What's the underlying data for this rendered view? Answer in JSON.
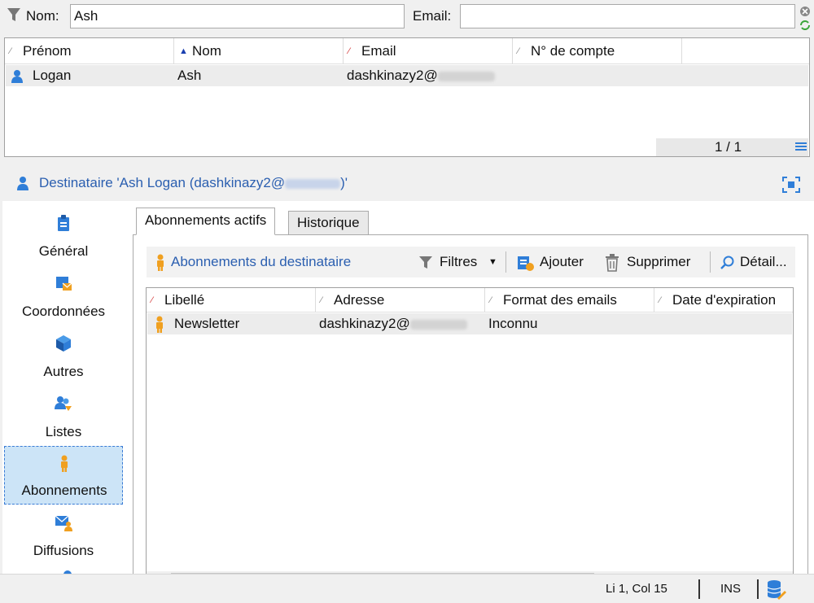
{
  "filter": {
    "nom_label": "Nom:",
    "nom_value": "Ash",
    "email_label": "Email:",
    "email_value": ""
  },
  "top_grid": {
    "columns": [
      "Prénom",
      "Nom",
      "Email",
      "N° de compte"
    ],
    "rows": [
      {
        "prenom": "Logan",
        "nom": "Ash",
        "email": "dashkinazy2@",
        "compte": ""
      }
    ],
    "pager": "1 / 1"
  },
  "recipient_header": {
    "title_prefix": "Destinataire 'Ash Logan (dashkinazy2@",
    "title_suffix": ")'"
  },
  "left_nav": {
    "items": [
      {
        "label": "Général",
        "icon": "clipboard-icon"
      },
      {
        "label": "Coordonnées",
        "icon": "contact-card-icon"
      },
      {
        "label": "Autres",
        "icon": "cube-icon"
      },
      {
        "label": "Listes",
        "icon": "group-list-icon"
      },
      {
        "label": "Abonnements",
        "icon": "subscription-person-icon",
        "selected": true
      },
      {
        "label": "Diffusions",
        "icon": "envelope-person-icon"
      }
    ]
  },
  "tabs": {
    "active": "Abonnements actifs",
    "other": "Historique"
  },
  "toolbar": {
    "title": "Abonnements du destinataire",
    "filtres": "Filtres",
    "ajouter": "Ajouter",
    "supprimer": "Supprimer",
    "detail": "Détail..."
  },
  "sub_grid": {
    "columns": [
      "Libellé",
      "Adresse",
      "Format des emails",
      "Date d'expiration"
    ],
    "rows": [
      {
        "libelle": "Newsletter",
        "adresse": "dashkinazy2@",
        "format": "Inconnu",
        "expiration": ""
      }
    ]
  },
  "status": {
    "position": "Li 1, Col 15",
    "mode": "INS"
  },
  "colors": {
    "accent_blue": "#2b5fb0",
    "selected_bg": "#cce4f7",
    "icon_orange": "#f0a020",
    "icon_blue": "#2f7ed8"
  }
}
